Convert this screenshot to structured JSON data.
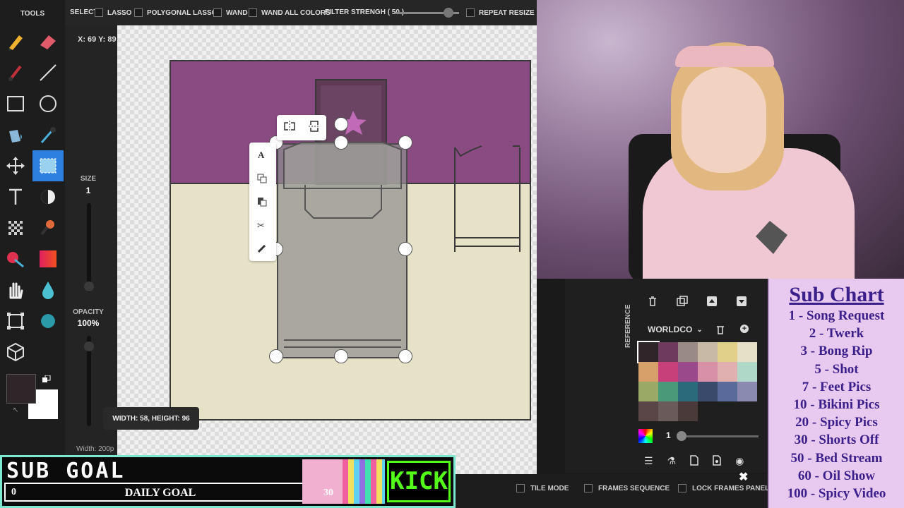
{
  "tools_panel": {
    "title": "TOOLS",
    "tools": [
      "pencil-icon",
      "eraser-icon",
      "brush-icon",
      "line-icon",
      "rectangle-icon",
      "ellipse-icon",
      "bucket-icon",
      "eyedropper-icon",
      "move-icon",
      "selection-icon",
      "text-icon",
      "shade-icon",
      "dither-icon",
      "stamp-icon",
      "color-replace-icon",
      "gradient-swatch-icon",
      "hand-icon",
      "droplet-icon",
      "crop-icon",
      "blob-icon",
      "cube-icon"
    ],
    "size_label": "SIZE",
    "size_value": "1",
    "opacity_label": "OPACITY",
    "opacity_value": "100%",
    "primary_color": "#2e2628",
    "secondary_color": "#ffffff",
    "width_label": "Width: 200p"
  },
  "topbar": {
    "select_label": "SELECT:",
    "lasso": "LASSO",
    "polygonal_lasso": "POLYGONAL LASSO",
    "wand": "WAND",
    "wand_all_colors": "WAND ALL COLORS",
    "filter_strength": "FILTER STRENGH ( 50 )",
    "filter_value": 0.83,
    "repeat_resize": "REPEAT RESIZE"
  },
  "canvas": {
    "coords": "X: 69 Y: 89",
    "size_tooltip": "WIDTH: 58, HEIGHT: 96",
    "wall_color": "#8a4a82",
    "floor_color": "#e6e2c8"
  },
  "context_menu": [
    "text-icon",
    "copy-icon",
    "paste-icon",
    "cut-icon",
    "brush-icon"
  ],
  "palette": {
    "reference_tab": "REFERENCE",
    "name": "WORLDCO",
    "colors": [
      "#2e2628",
      "#6e3a5e",
      "#9a8a86",
      "#c8b8a6",
      "#e0d08a",
      "#e6e0c8",
      "#d6a06a",
      "#c8407a",
      "#9a4a8a",
      "#d890a8",
      "#e0b0b0",
      "#b0d8c8",
      "#9aaa66",
      "#4a9a7a",
      "#2a6a7a",
      "#3a4a6a",
      "#5a6a9a",
      "#8a8ab0",
      "#5a4646",
      "#6a5a5a",
      "#4a3a3a"
    ],
    "layer_value": "1"
  },
  "bottombar": {
    "tile_mode": "TILE MODE",
    "frames_sequence": "FRAMES SEQUENCE",
    "lock_frames": "LOCK FRAMES PANEL"
  },
  "subgoal": {
    "title": "SUB GOAL",
    "current": "0",
    "label": "DAILY GOAL",
    "target": "30",
    "progress": 0,
    "brand": "KICK"
  },
  "subchart": {
    "title": "Sub Chart",
    "items": [
      "1 - Song Request",
      "2 - Twerk",
      "3 - Bong Rip",
      "5 - Shot",
      "7 - Feet Pics",
      "10 - Bikini Pics",
      "20 - Spicy Pics",
      "30 - Shorts Off",
      "50 - Bed Stream",
      "60 - Oil Show",
      "100 - Spicy Video"
    ]
  }
}
